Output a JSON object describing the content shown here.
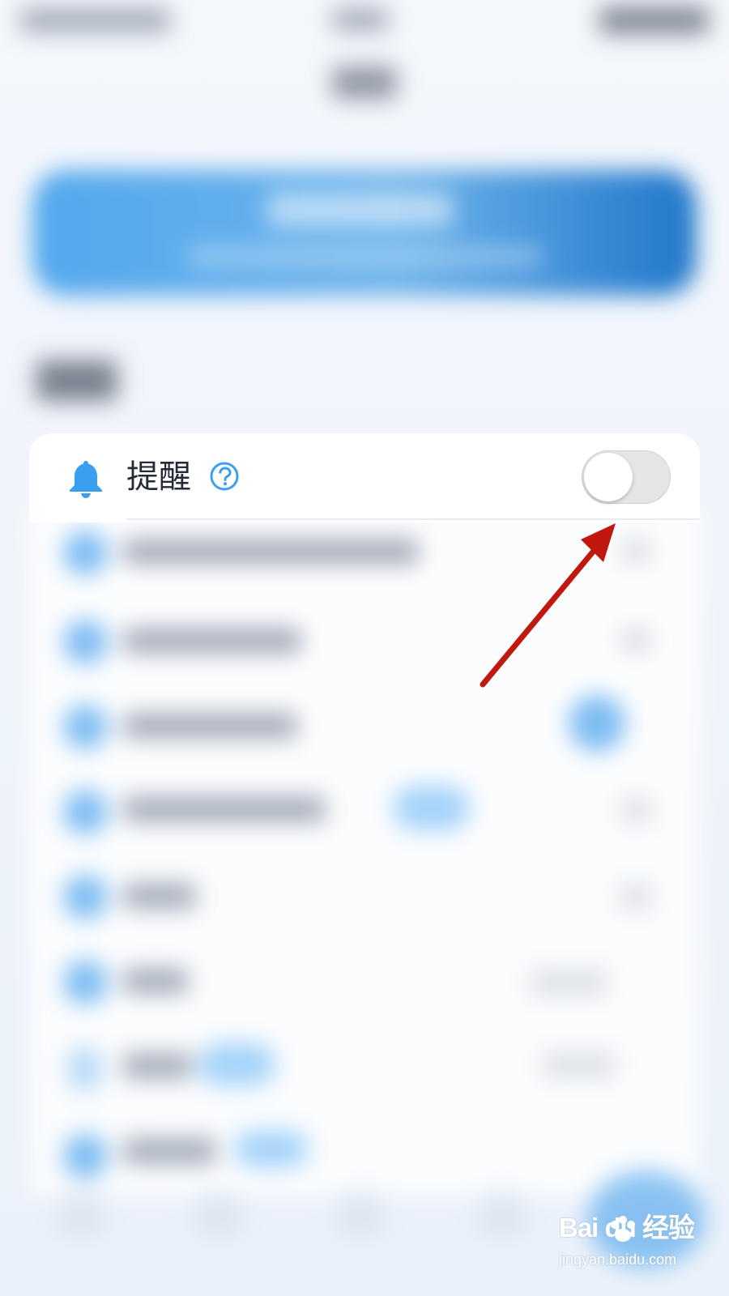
{
  "reminder": {
    "label": "提醒",
    "toggle_enabled": false,
    "icon": "bell-icon",
    "help_icon": "help-icon"
  },
  "watermark": {
    "brand": "Bai du 经验",
    "url": "jingyan.baidu.com"
  },
  "colors": {
    "primary_blue": "#3aa0f4",
    "arrow_red": "#c0170f",
    "toggle_off": "#e5e5e5"
  }
}
